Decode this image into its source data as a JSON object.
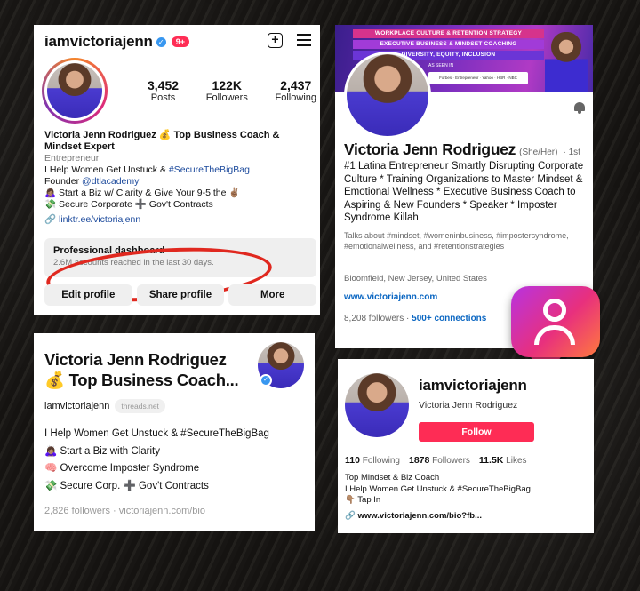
{
  "instagram": {
    "username": "iamvictoriajenn",
    "notification_count": "9+",
    "stats": [
      {
        "value": "3,452",
        "label": "Posts"
      },
      {
        "value": "122K",
        "label": "Followers"
      },
      {
        "value": "2,437",
        "label": "Following"
      }
    ],
    "bio_name": "Victoria Jenn Rodriguez 💰 Top Business Coach & Mindset Expert",
    "category": "Entrepreneur",
    "bio_line1_prefix": "I Help Women Get Unstuck & ",
    "bio_line1_hashtag": "#SecureTheBigBag",
    "bio_line2_prefix": "Founder ",
    "bio_line2_mention": "@dtlacademy",
    "bio_line3": "🙇🏽‍♀️ Start a Biz w/ Clarity & Give Your 9-5 the ✌🏽",
    "bio_line4": "💸 Secure Corporate ➕ Gov't Contracts",
    "link": "🔗 linktr.ee/victoriajenn",
    "dashboard_title": "Professional dashboard",
    "dashboard_subtitle": "2.6M accounts reached in the last 30 days.",
    "buttons": [
      "Edit profile",
      "Share profile",
      "More"
    ]
  },
  "linkedin": {
    "banner_line1": "WORKPLACE CULTURE & RETENTION STRATEGY",
    "banner_line2": "EXECUTIVE BUSINESS & MINDSET COACHING",
    "banner_line3": "DIVERSITY, EQUITY, INCLUSION",
    "banner_featured": "AS SEEN IN",
    "banner_logos": "Forbes  ·  Entrepreneur  ·  Yahoo  ·  HBR  ·  NBC",
    "name": "Victoria Jenn Rodriguez",
    "pronouns": "(She/Her)",
    "degree": "· 1st",
    "headline": "#1 Latina Entrepreneur Smartly Disrupting Corporate Culture * Training Organizations to Master Mindset & Emotional Wellness * Executive Business Coach to Aspiring & New Founders * Speaker * Imposter Syndrome Killah",
    "talks_about": "Talks about #mindset, #womeninbusiness, #impostersyndrome, #emotionalwellness, and #retentionstrategies",
    "location": "Bloomfield, New Jersey, United States",
    "website": "www.victoriajenn.com",
    "followers": "8,208 followers · ",
    "connections": "500+ connections"
  },
  "threads": {
    "title_line1": "Victoria Jenn Rodriguez",
    "title_line2": "💰 Top Business Coach...",
    "handle": "iamvictoriajenn",
    "domain": "threads.net",
    "bio": [
      "I Help Women Get Unstuck & #SecureTheBigBag",
      "🙇🏽‍♀️ Start a Biz with Clarity",
      "🧠 Overcome Imposter Syndrome",
      "💸 Secure Corp. ➕ Gov't Contracts"
    ],
    "footer": "2,826 followers · victoriajenn.com/bio"
  },
  "tiktok": {
    "username": "iamvictoriajenn",
    "display_name": "Victoria Jenn Rodriguez",
    "follow_label": "Follow",
    "following_count": "110",
    "following_label": "Following",
    "followers_count": "1878",
    "followers_label": "Followers",
    "likes_count": "11.5K",
    "likes_label": "Likes",
    "bio": [
      "Top Mindset & Biz Coach",
      "I Help Women Get Unstuck & #SecureTheBigBag",
      "👇🏽 Tap In"
    ],
    "link": "🔗 www.victoriajenn.com/bio?fb..."
  },
  "colors": {
    "instagram_link": "#1c4a9c",
    "linkedin_blue": "#0a66c2",
    "tiktok_red": "#fe2c55",
    "annotation_red": "#e0281f",
    "verified_blue": "#3897f0"
  }
}
